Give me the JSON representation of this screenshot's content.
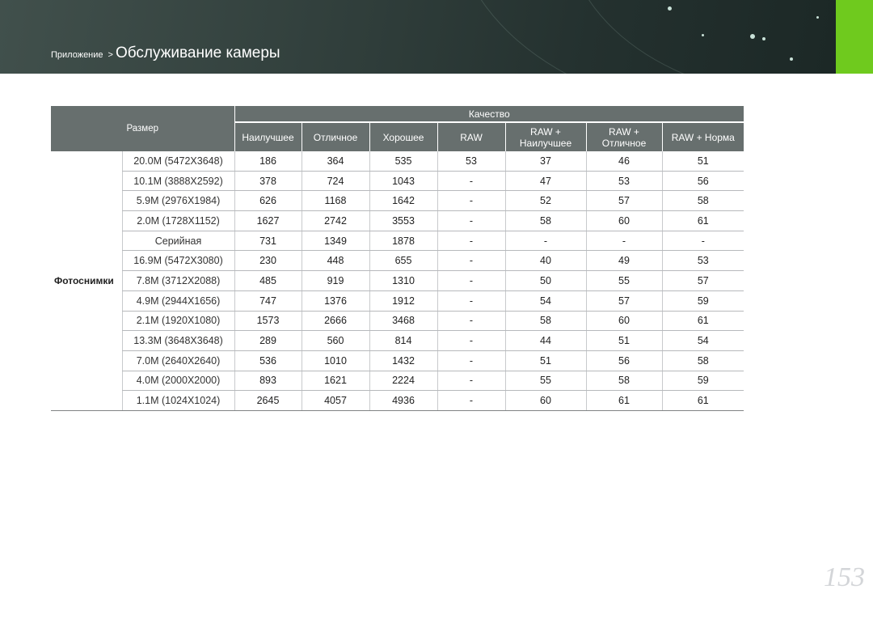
{
  "header": {
    "breadcrumb_parent": "Приложение",
    "breadcrumb_separator": ">",
    "title": "Обслуживание камеры",
    "accent_color": "#6fca1e"
  },
  "table": {
    "size_header": "Размер",
    "quality_header": "Качество",
    "columns": [
      "Наилучшее",
      "Отличное",
      "Хорошее",
      "RAW",
      "RAW + Наилучшее",
      "RAW + Отличное",
      "RAW + Норма"
    ],
    "row_group_label": "Фотоснимки",
    "rows": [
      {
        "size": "20.0M (5472X3648)",
        "values": [
          "186",
          "364",
          "535",
          "53",
          "37",
          "46",
          "51"
        ]
      },
      {
        "size": "10.1M (3888X2592)",
        "values": [
          "378",
          "724",
          "1043",
          "-",
          "47",
          "53",
          "56"
        ]
      },
      {
        "size": "5.9M (2976X1984)",
        "values": [
          "626",
          "1168",
          "1642",
          "-",
          "52",
          "57",
          "58"
        ]
      },
      {
        "size": "2.0M (1728X1152)",
        "values": [
          "1627",
          "2742",
          "3553",
          "-",
          "58",
          "60",
          "61"
        ]
      },
      {
        "size": "Серийная",
        "values": [
          "731",
          "1349",
          "1878",
          "-",
          "-",
          "-",
          "-"
        ]
      },
      {
        "size": "16.9M (5472X3080)",
        "values": [
          "230",
          "448",
          "655",
          "-",
          "40",
          "49",
          "53"
        ]
      },
      {
        "size": "7.8M (3712X2088)",
        "values": [
          "485",
          "919",
          "1310",
          "-",
          "50",
          "55",
          "57"
        ]
      },
      {
        "size": "4.9M (2944X1656)",
        "values": [
          "747",
          "1376",
          "1912",
          "-",
          "54",
          "57",
          "59"
        ]
      },
      {
        "size": "2.1M (1920X1080)",
        "values": [
          "1573",
          "2666",
          "3468",
          "-",
          "58",
          "60",
          "61"
        ]
      },
      {
        "size": "13.3M (3648X3648)",
        "values": [
          "289",
          "560",
          "814",
          "-",
          "44",
          "51",
          "54"
        ]
      },
      {
        "size": "7.0M (2640X2640)",
        "values": [
          "536",
          "1010",
          "1432",
          "-",
          "51",
          "56",
          "58"
        ]
      },
      {
        "size": "4.0M (2000X2000)",
        "values": [
          "893",
          "1621",
          "2224",
          "-",
          "55",
          "58",
          "59"
        ]
      },
      {
        "size": "1.1M (1024X1024)",
        "values": [
          "2645",
          "4057",
          "4936",
          "-",
          "60",
          "61",
          "61"
        ]
      }
    ]
  },
  "page_number": "153"
}
